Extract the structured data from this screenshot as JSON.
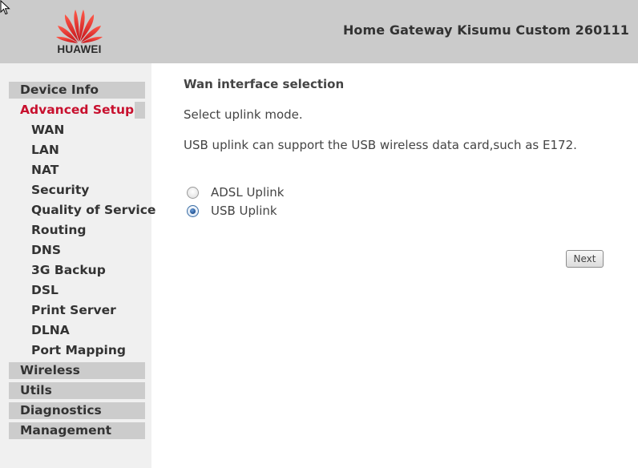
{
  "header": {
    "brand": "HUAWEI",
    "title": "Home Gateway Kisumu Custom 260111",
    "brand_color": "#e2231a"
  },
  "sidebar": {
    "items": [
      {
        "label": "Device Info",
        "level": 0,
        "active": false
      },
      {
        "label": "Advanced Setup",
        "level": 0,
        "active": true
      },
      {
        "label": "WAN",
        "level": 1
      },
      {
        "label": "LAN",
        "level": 1
      },
      {
        "label": "NAT",
        "level": 1
      },
      {
        "label": "Security",
        "level": 1
      },
      {
        "label": "Quality of Service",
        "level": 1
      },
      {
        "label": "Routing",
        "level": 1
      },
      {
        "label": "DNS",
        "level": 1
      },
      {
        "label": "3G Backup",
        "level": 1
      },
      {
        "label": "DSL",
        "level": 1
      },
      {
        "label": "Print Server",
        "level": 1
      },
      {
        "label": "DLNA",
        "level": 1
      },
      {
        "label": "Port Mapping",
        "level": 1
      },
      {
        "label": "Wireless",
        "level": 0,
        "active": false
      },
      {
        "label": "Utils",
        "level": 0,
        "active": false
      },
      {
        "label": "Diagnostics",
        "level": 0,
        "active": false
      },
      {
        "label": "Management",
        "level": 0,
        "active": false
      }
    ],
    "active_color": "#c8102e"
  },
  "main": {
    "title": "Wan interface selection",
    "instruction": "Select uplink mode.",
    "note": "USB uplink can support the USB wireless data card,such as E172.",
    "uplink_options": [
      {
        "label": "ADSL Uplink",
        "checked": false
      },
      {
        "label": "USB Uplink",
        "checked": true
      }
    ],
    "next_label": "Next"
  }
}
